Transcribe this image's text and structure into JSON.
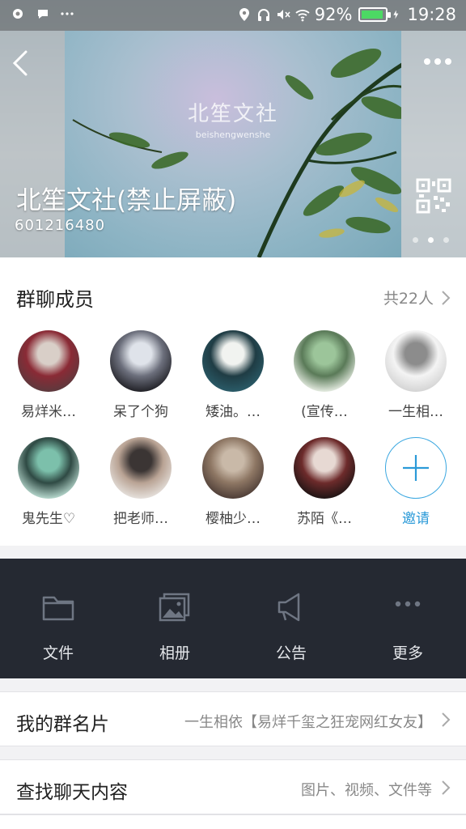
{
  "status_bar": {
    "battery_percent": "92%",
    "battery_level": 0.92,
    "time": "19:28",
    "left_icons": [
      "notification-icon",
      "chat-bubble-icon",
      "more-notifications-icon"
    ],
    "right_icons": [
      "location-icon",
      "headphones-icon",
      "mute-icon",
      "wifi-icon",
      "battery-icon",
      "charging-icon"
    ]
  },
  "header": {
    "banner_title": "北笙文社",
    "banner_subtitle": "beishengwenshe",
    "group_name": "北笙文社(禁止屏蔽)",
    "group_id": "601216480",
    "page_indicator": {
      "total": 3,
      "active_index": 1
    }
  },
  "members": {
    "title": "群聊成员",
    "count_label": "共22人",
    "items": [
      {
        "label": "易烊米…",
        "palette": [
          "#5a3a3e",
          "#d9cfc8",
          "#8a2a35"
        ]
      },
      {
        "label": "呆了个狗",
        "palette": [
          "#1d1d22",
          "#dfe3ea",
          "#6c6f7c"
        ]
      },
      {
        "label": "矮油。…",
        "palette": [
          "#2b5d6a",
          "#f1f3f0",
          "#1f3c44"
        ]
      },
      {
        "label": "(宣传…",
        "palette": [
          "#eef3ea",
          "#9cc59a",
          "#5a7a58"
        ]
      },
      {
        "label": "一生相…",
        "palette": [
          "#d2d2d2",
          "#8c8c8c",
          "#f4f4f4"
        ]
      },
      {
        "label": "鬼先生♡",
        "palette": [
          "#bfe1d6",
          "#7cc0ab",
          "#2f4a44"
        ]
      },
      {
        "label": "把老师…",
        "palette": [
          "#e8e4e0",
          "#3b3534",
          "#b9a394"
        ]
      },
      {
        "label": "樱柚少…",
        "palette": [
          "#4a3a34",
          "#c9b9a8",
          "#8e7764"
        ]
      },
      {
        "label": "苏陌《…",
        "palette": [
          "#1a1313",
          "#e7d9d3",
          "#6d2b2b"
        ]
      }
    ],
    "invite_label": "邀请"
  },
  "toolbar": {
    "items": [
      {
        "label": "文件",
        "icon": "folder-icon"
      },
      {
        "label": "相册",
        "icon": "photo-album-icon"
      },
      {
        "label": "公告",
        "icon": "megaphone-icon"
      },
      {
        "label": "更多",
        "icon": "more-icon"
      }
    ]
  },
  "rows": {
    "card": {
      "label": "我的群名片",
      "value": "一生相依【易烊千玺之狂宠网红女友】"
    },
    "search": {
      "label": "查找聊天内容",
      "value": "图片、视频、文件等"
    }
  },
  "colors": {
    "toolbar_bg": "#252932",
    "accent": "#2b9ad8",
    "battery_green": "#4cd964"
  }
}
